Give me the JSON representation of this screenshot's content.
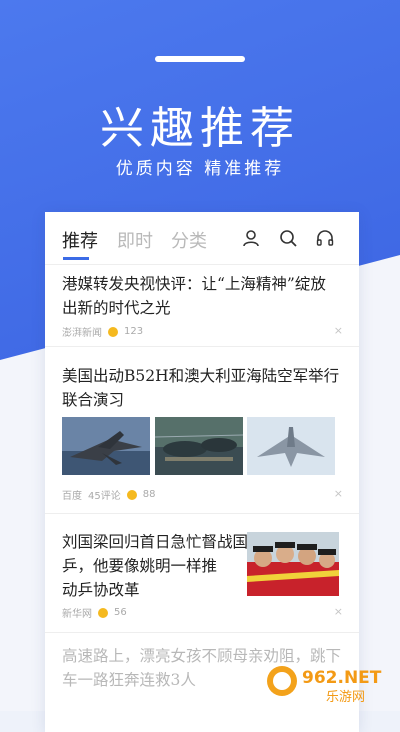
{
  "hero": {
    "title": "兴趣推荐",
    "subtitle": "优质内容  精准推荐"
  },
  "tabs": [
    {
      "label": "推荐",
      "active": true
    },
    {
      "label": "即时",
      "active": false
    },
    {
      "label": "分类",
      "active": false
    }
  ],
  "toolbar": {
    "icons": [
      "user-icon",
      "search-icon",
      "headphones-icon"
    ]
  },
  "news": [
    {
      "title_line1": "港媒转发央视快评：让“上海精神”绽放",
      "title_line2": "出新的时代之光",
      "source": "澎湃新闻",
      "reactions": "123"
    },
    {
      "title_line1": "美国出动B52H和澳大利亚海陆空军举行",
      "title_line2": "联合演习",
      "source": "百度",
      "comments": "45评论",
      "reactions": "88"
    },
    {
      "title_line1": "刘国梁回归首日急忙督战国",
      "title_line2": "乒，他要像姚明一样推",
      "title_line3": "动乒协改革",
      "source": "新华网",
      "reactions": "56"
    },
    {
      "title_line1": "高速路上，漂亮女孩不顾母亲劝阻，跳下",
      "title_line2": "车一路狂奔连救3人"
    }
  ],
  "close_symbol": "×",
  "watermark": {
    "brand": "962.NET",
    "site": "乐游网"
  },
  "colors": {
    "accent": "#3b6be6",
    "hero_bg": "#4470e8",
    "reaction_emoji": "#f5b91f"
  }
}
